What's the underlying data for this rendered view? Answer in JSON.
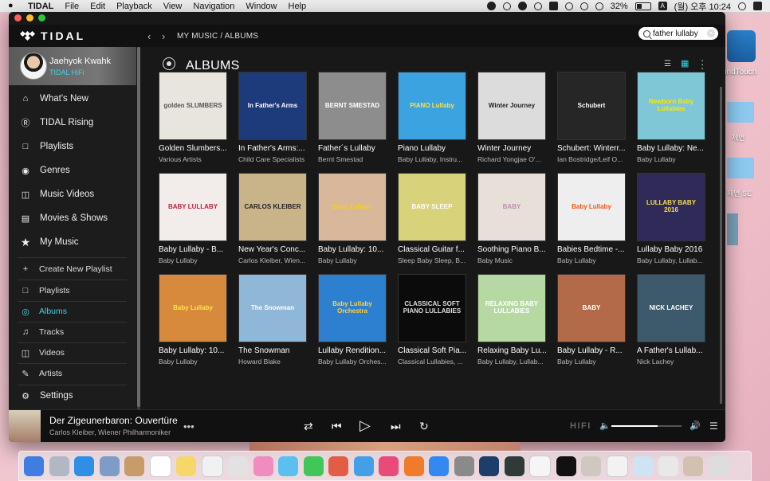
{
  "menubar": {
    "app": "TIDAL",
    "menus": [
      "File",
      "Edit",
      "Playback",
      "View",
      "Navigation",
      "Window",
      "Help"
    ],
    "battery": "32%",
    "input_lang": "A",
    "clock": "(월) 오후 10:24"
  },
  "desktop": {
    "bose_label": "undTouch",
    "folder1_label": "제연",
    "folder2_label": "재연 SE"
  },
  "topbar": {
    "logo": "TIDAL",
    "breadcrumb": "MY MUSIC / ALBUMS",
    "search_value": "father lullaby"
  },
  "profile": {
    "name": "Jaehyok Kwahk",
    "plan": "TIDAL HiFi"
  },
  "sidebar": {
    "main": [
      {
        "label": "What's New",
        "icon": "home-icon"
      },
      {
        "label": "TIDAL Rising",
        "icon": "rising-icon"
      },
      {
        "label": "Playlists",
        "icon": "playlist-icon"
      },
      {
        "label": "Genres",
        "icon": "genres-icon"
      },
      {
        "label": "Music Videos",
        "icon": "video-icon"
      },
      {
        "label": "Movies & Shows",
        "icon": "film-icon"
      },
      {
        "label": "My Music",
        "icon": "star-icon"
      }
    ],
    "sub": [
      {
        "label": "Create New Playlist",
        "icon": "plus-icon"
      },
      {
        "label": "Playlists",
        "icon": "playlist-icon"
      },
      {
        "label": "Albums",
        "icon": "album-icon"
      },
      {
        "label": "Tracks",
        "icon": "note-icon"
      },
      {
        "label": "Videos",
        "icon": "video-icon"
      },
      {
        "label": "Artists",
        "icon": "mic-icon"
      }
    ],
    "settings": "Settings"
  },
  "main": {
    "title": "ALBUMS",
    "albums": [
      {
        "title": "Golden Slumbers...",
        "artist": "Various Artists",
        "bg": "#e8e4de",
        "fg": "#555",
        "text": "golden SLUMBERS"
      },
      {
        "title": "In Father's Arms:...",
        "artist": "Child Care Specialists",
        "bg": "#1d3a7a",
        "fg": "#fff",
        "text": "In Father's Arms"
      },
      {
        "title": "Father´s Lullaby",
        "artist": "Bernt Smestad",
        "bg": "#8d8d8d",
        "fg": "#fff",
        "text": "BERNT SMESTAD"
      },
      {
        "title": "Piano Lullaby",
        "artist": "Baby Lullaby, Instru...",
        "bg": "#3aa3e0",
        "fg": "#ffe14a",
        "text": "PIANO Lullaby"
      },
      {
        "title": "Winter Journey",
        "artist": "Richard Yongjae O'...",
        "bg": "#dcdcdc",
        "fg": "#222",
        "text": "Winter Journey"
      },
      {
        "title": "Schubert: Winterr...",
        "artist": "Ian Bostridge/Leif O...",
        "bg": "#262626",
        "fg": "#fff",
        "text": "Schubert"
      },
      {
        "title": "Baby Lullaby: Ne...",
        "artist": "Baby Lullaby",
        "bg": "#7fc7d6",
        "fg": "#ffe600",
        "text": "Newborn Baby Lullabies"
      },
      {
        "title": "Baby Lullaby - B...",
        "artist": "Baby Lullaby",
        "bg": "#f2ecea",
        "fg": "#c2233a",
        "text": "BABY LULLABY"
      },
      {
        "title": "New Year's Conc...",
        "artist": "Carlos Kleiber, Wien...",
        "bg": "#c9b48a",
        "fg": "#222",
        "text": "CARLOS KLEIBER"
      },
      {
        "title": "Baby Lullaby: 10...",
        "artist": "Baby Lullaby",
        "bg": "#d9b79a",
        "fg": "#f3d21a",
        "text": "Baby Lullaby"
      },
      {
        "title": "Classical Guitar f...",
        "artist": "Sleep Baby Sleep, B...",
        "bg": "#d8d27a",
        "fg": "#fff",
        "text": "BABY SLEEP"
      },
      {
        "title": "Soothing Piano B...",
        "artist": "Baby Music",
        "bg": "#e8e0d8",
        "fg": "#c08bb0",
        "text": "BABY"
      },
      {
        "title": "Babies Bedtime -...",
        "artist": "Baby Lullaby",
        "bg": "#eeeeee",
        "fg": "#e85b1a",
        "text": "Baby Lullaby"
      },
      {
        "title": "Lullaby Baby 2016",
        "artist": "Baby Lullaby, Lullab...",
        "bg": "#2f2a57",
        "fg": "#f4e04b",
        "text": "LULLABY BABY 2016"
      },
      {
        "title": "Baby Lullaby: 10...",
        "artist": "Baby Lullaby",
        "bg": "#d88a3c",
        "fg": "#ffe34a",
        "text": "Baby Lullaby"
      },
      {
        "title": "The Snowman",
        "artist": "Howard Blake",
        "bg": "#8fb7d8",
        "fg": "#fff",
        "text": "The Snowman"
      },
      {
        "title": "Lullaby Rendition...",
        "artist": "Baby Lullaby Orches...",
        "bg": "#2d7fd0",
        "fg": "#ffd43a",
        "text": "Baby Lullaby Orchestra"
      },
      {
        "title": "Classical Soft Pia...",
        "artist": "Classical Lullabies, ...",
        "bg": "#0b0b0b",
        "fg": "#ddd",
        "text": "CLASSICAL SOFT PIANO LULLABIES"
      },
      {
        "title": "Relaxing Baby Lu...",
        "artist": "Baby Lullaby, Lullab...",
        "bg": "#b6d9a3",
        "fg": "#fff",
        "text": "RELAXING BABY LULLABIES"
      },
      {
        "title": "Baby Lullaby - R...",
        "artist": "Baby Lullaby",
        "bg": "#b26a48",
        "fg": "#fff",
        "text": "BABY"
      },
      {
        "title": "A Father's Lullab...",
        "artist": "Nick Lachey",
        "bg": "#3c5a6c",
        "fg": "#fff",
        "text": "NICK LACHEY"
      }
    ]
  },
  "player": {
    "title": "Der Zigeunerbaron: Ouvertüre",
    "artist": "Carlos Kleiber, Wiener Philharmoniker",
    "hifi": "HIFI",
    "volume": 0.66
  },
  "dock": {
    "colors": [
      "#3f7de0",
      "#b0b8c4",
      "#2f8fe6",
      "#7e9cc6",
      "#c89b6a",
      "#ffffff",
      "#f6d86a",
      "#f1f1f1",
      "#e2e2e2",
      "#f08cc0",
      "#5bc0f0",
      "#43c658",
      "#e25d45",
      "#44a0e6",
      "#e94a7a",
      "#f07b2b",
      "#3389f0",
      "#8a8a8a",
      "#1d3d6b",
      "#2f3b38",
      "#f5f5f5",
      "#111111",
      "#d0c8c0",
      "#f2f2f2",
      "#cfe4f2",
      "#e8e8e8",
      "#d4c0b0",
      "#dddddd"
    ]
  }
}
